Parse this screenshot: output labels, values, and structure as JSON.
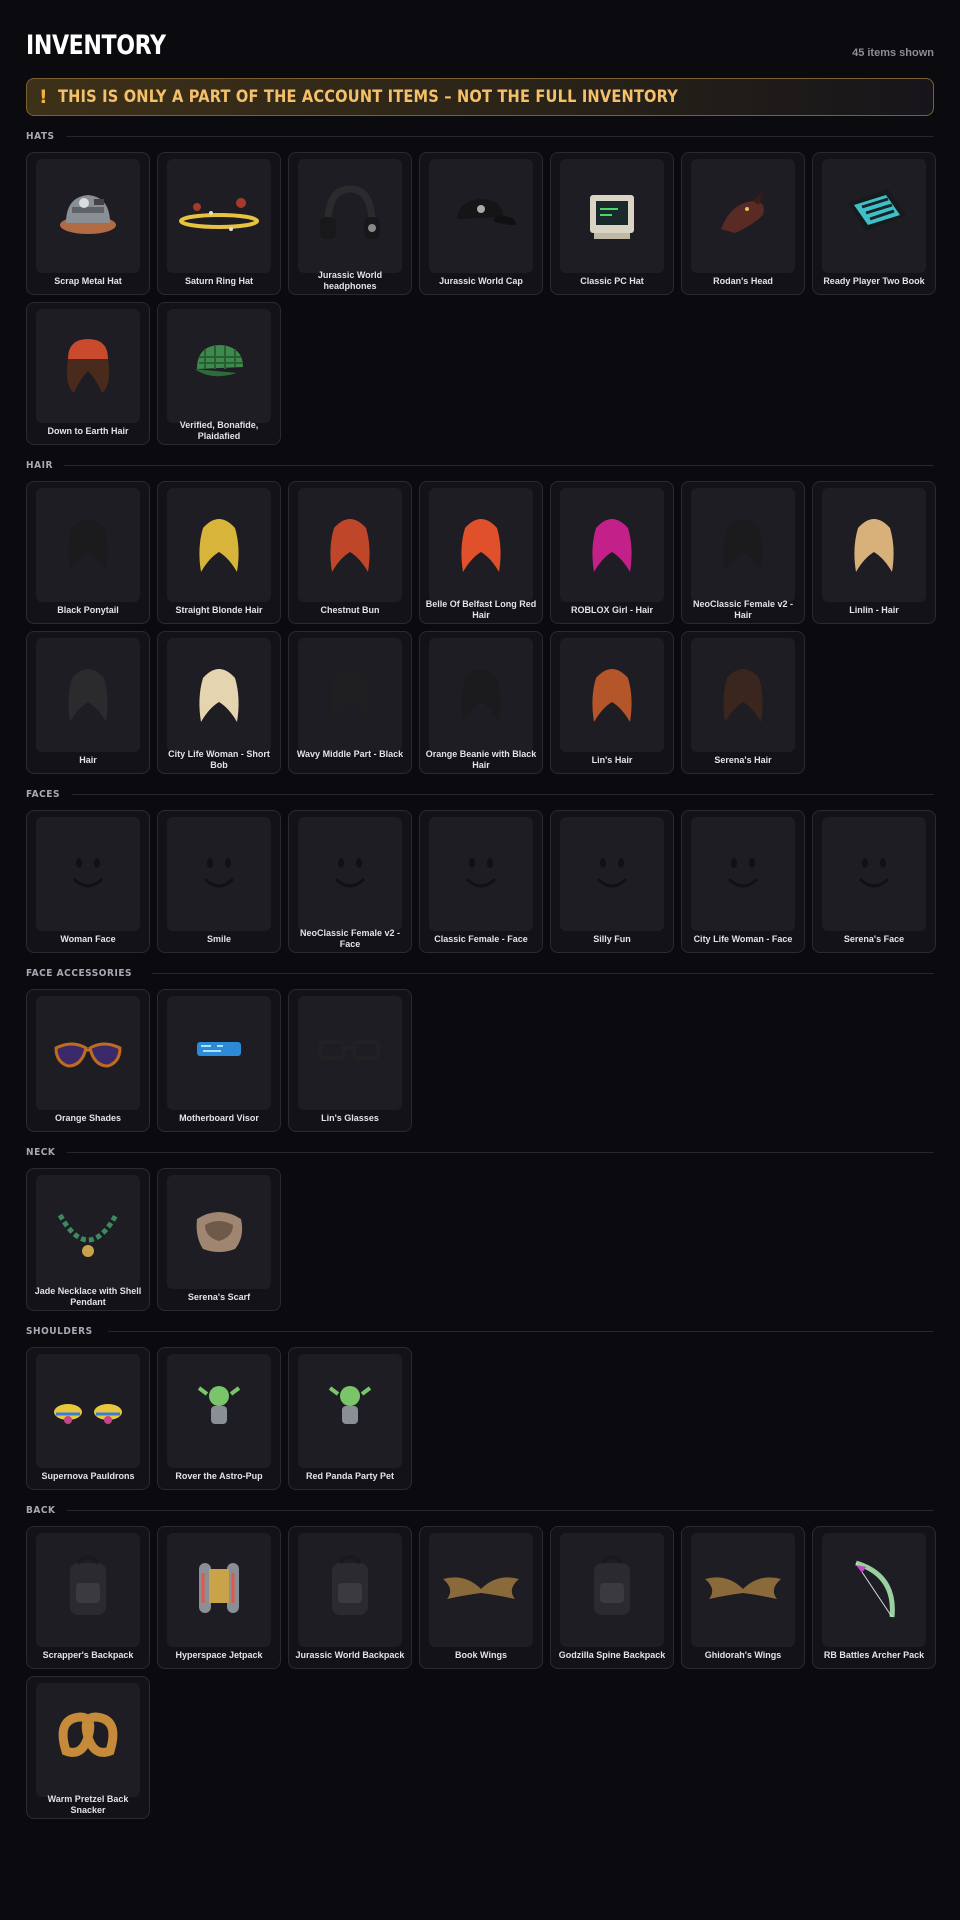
{
  "header": {
    "title": "INVENTORY",
    "count": "45 items shown"
  },
  "notice": {
    "icon": "!",
    "text": "THIS IS ONLY A PART OF THE ACCOUNT ITEMS – NOT THE FULL INVENTORY"
  },
  "colors": {
    "background": "#0a0a0f",
    "card": "#121217",
    "thumb": "#1d1d23",
    "notice_text": "#f4c069",
    "notice_border": "#7a6130"
  },
  "sections": [
    {
      "label": "HATS",
      "items": [
        {
          "name": "Scrap Metal Hat",
          "icon": "scrap-metal-hat-icon"
        },
        {
          "name": "Saturn Ring Hat",
          "icon": "saturn-ring-hat-icon"
        },
        {
          "name": "Jurassic World headphones",
          "icon": "headphones-icon"
        },
        {
          "name": "Jurassic World Cap",
          "icon": "cap-icon"
        },
        {
          "name": "Classic PC Hat",
          "icon": "pc-monitor-icon"
        },
        {
          "name": "Rodan's Head",
          "icon": "dragon-head-icon"
        },
        {
          "name": "Ready Player Two Book",
          "icon": "book-icon"
        },
        {
          "name": "Down to Earth Hair",
          "icon": "beanie-hair-icon"
        },
        {
          "name": "Verified, Bonafide, Plaidafied",
          "icon": "plaid-cap-icon"
        }
      ]
    },
    {
      "label": "HAIR",
      "items": [
        {
          "name": "Black Ponytail",
          "icon": "hair-icon"
        },
        {
          "name": "Straight Blonde Hair",
          "icon": "hair-icon"
        },
        {
          "name": "Chestnut Bun",
          "icon": "hair-icon"
        },
        {
          "name": "Belle Of Belfast Long Red Hair",
          "icon": "hair-icon"
        },
        {
          "name": "ROBLOX Girl - Hair",
          "icon": "hair-icon"
        },
        {
          "name": "NeoClassic Female v2 - Hair",
          "icon": "hair-icon"
        },
        {
          "name": "Linlin - Hair",
          "icon": "hair-icon"
        },
        {
          "name": "Hair",
          "icon": "hair-icon"
        },
        {
          "name": "City Life Woman - Short Bob",
          "icon": "hair-icon"
        },
        {
          "name": "Wavy Middle Part - Black",
          "icon": "hair-icon"
        },
        {
          "name": "Orange Beanie with Black Hair",
          "icon": "hair-icon"
        },
        {
          "name": "Lin's Hair",
          "icon": "hair-icon"
        },
        {
          "name": "Serena's Hair",
          "icon": "hair-icon"
        }
      ]
    },
    {
      "label": "FACES",
      "items": [
        {
          "name": "Woman Face",
          "icon": "face-icon"
        },
        {
          "name": "Smile",
          "icon": "face-icon"
        },
        {
          "name": "NeoClassic Female v2 - Face",
          "icon": "face-icon"
        },
        {
          "name": "Classic Female - Face",
          "icon": "face-icon"
        },
        {
          "name": "Silly Fun",
          "icon": "face-icon"
        },
        {
          "name": "City Life Woman - Face",
          "icon": "face-icon"
        },
        {
          "name": "Serena's Face",
          "icon": "face-icon"
        }
      ]
    },
    {
      "label": "FACE ACCESSORIES",
      "items": [
        {
          "name": "Orange Shades",
          "icon": "sunglasses-icon"
        },
        {
          "name": "Motherboard Visor",
          "icon": "visor-icon"
        },
        {
          "name": "Lin's Glasses",
          "icon": "glasses-icon"
        }
      ]
    },
    {
      "label": "NECK",
      "items": [
        {
          "name": "Jade Necklace with Shell Pendant",
          "icon": "necklace-icon"
        },
        {
          "name": "Serena's Scarf",
          "icon": "scarf-icon"
        }
      ]
    },
    {
      "label": "SHOULDERS",
      "items": [
        {
          "name": "Supernova Pauldrons",
          "icon": "pauldrons-icon"
        },
        {
          "name": "Rover the Astro-Pup",
          "icon": "pet-icon"
        },
        {
          "name": "Red Panda Party Pet",
          "icon": "pet-icon"
        }
      ]
    },
    {
      "label": "BACK",
      "items": [
        {
          "name": "Scrapper's Backpack",
          "icon": "backpack-icon"
        },
        {
          "name": "Hyperspace Jetpack",
          "icon": "jetpack-icon"
        },
        {
          "name": "Jurassic World Backpack",
          "icon": "backpack-icon"
        },
        {
          "name": "Book Wings",
          "icon": "wings-icon"
        },
        {
          "name": "Godzilla Spine Backpack",
          "icon": "backpack-icon"
        },
        {
          "name": "Ghidorah's Wings",
          "icon": "wings-icon"
        },
        {
          "name": "RB Battles Archer Pack",
          "icon": "bow-icon"
        },
        {
          "name": "Warm Pretzel Back Snacker",
          "icon": "pretzel-icon"
        }
      ]
    }
  ]
}
